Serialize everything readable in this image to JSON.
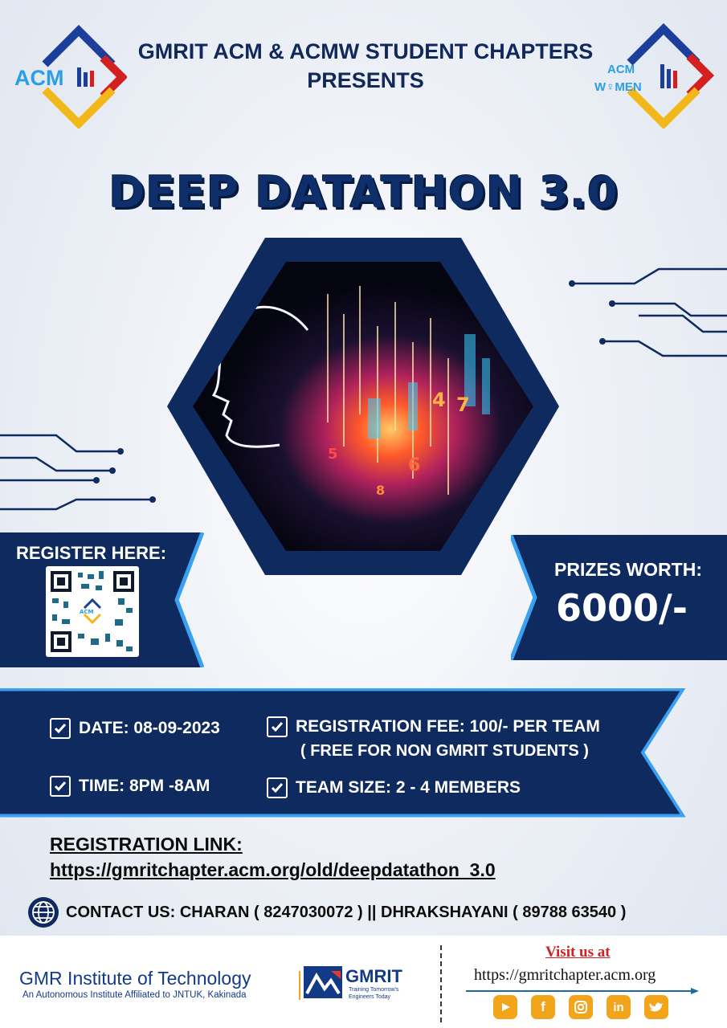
{
  "header": {
    "line1": "GMRIT ACM & ACMW STUDENT CHAPTERS",
    "line2": "PRESENTS",
    "acm_logo_text": "ACM",
    "acmw_logo_top": "ACM",
    "acmw_logo_bottom": "W♀MEN"
  },
  "event": {
    "title": "DEEP DATATHON 3.0"
  },
  "register": {
    "label": "REGISTER HERE:"
  },
  "prizes": {
    "label": "PRIZES WORTH:",
    "amount": "6000/-"
  },
  "details": {
    "date": "DATE: 08-09-2023",
    "time": "TIME: 8PM -8AM",
    "fee": "REGISTRATION FEE: 100/-  PER TEAM",
    "fee_note": "( FREE FOR NON GMRIT STUDENTS )",
    "team_size": "TEAM SIZE: 2 - 4 MEMBERS"
  },
  "registration": {
    "label": "REGISTRATION LINK:",
    "url": "https://gmritchapter.acm.org/old/deepdatathon_3.0"
  },
  "contact": {
    "text": "CONTACT US:  CHARAN ( 8247030072 ) || DHRAKSHAYANI ( 89788 63540 )"
  },
  "footer": {
    "institute": "GMR Institute of Technology",
    "institute_sub": "An Autonomous Institute Affiliated to JNTUK, Kakinada",
    "brand": "GMRIT",
    "brand_tagline_1": "Training Tomorrow's",
    "brand_tagline_2": "Engineers Today",
    "visit_label": "Visit us at",
    "visit_url": "https://gmritchapter.acm.org",
    "social": [
      "youtube-icon",
      "facebook-icon",
      "instagram-icon",
      "linkedin-icon",
      "twitter-icon"
    ]
  },
  "colors": {
    "navy": "#0f2a5e",
    "accent_blue": "#3aa0f0",
    "orange": "#f2a51a",
    "red": "#d42020"
  }
}
